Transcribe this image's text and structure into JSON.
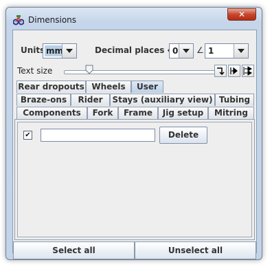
{
  "window": {
    "title": "Dimensions",
    "close_label": "✕"
  },
  "units": {
    "label": "Units",
    "value": "mm"
  },
  "decimal": {
    "label": "Decimal places ↔",
    "length_value": "0",
    "angle_symbol": "∠",
    "angle_value": "1"
  },
  "text_size": {
    "label": "Text size",
    "level": 0.2
  },
  "tabs": {
    "row1": [
      "Rear dropouts",
      "Wheels",
      "User"
    ],
    "row2": [
      "Braze-ons",
      "Rider",
      "Stays (auxiliary view)",
      "Tubing"
    ],
    "row3": [
      "Components",
      "Fork",
      "Frame",
      "Jig setup",
      "Mitring"
    ],
    "active": "User"
  },
  "user_row": {
    "checked_mark": "✔",
    "text_value": "",
    "delete_label": "Delete"
  },
  "footer": {
    "select_all": "Select all",
    "unselect_all": "Unselect all"
  }
}
